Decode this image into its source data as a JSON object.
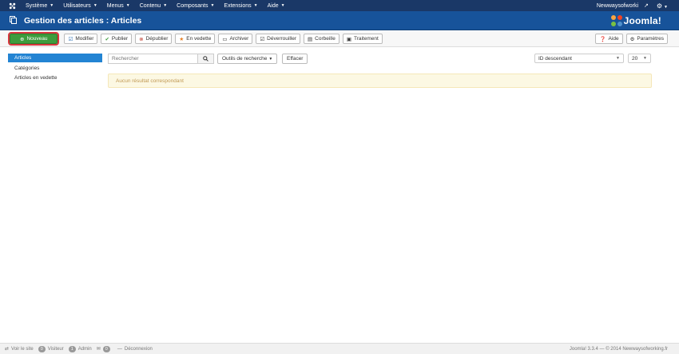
{
  "topnav": {
    "menus": [
      {
        "label": "Système"
      },
      {
        "label": "Utilisateurs"
      },
      {
        "label": "Menus"
      },
      {
        "label": "Contenu"
      },
      {
        "label": "Composants"
      },
      {
        "label": "Extensions"
      },
      {
        "label": "Aide"
      }
    ],
    "user": "Newwaysofworki"
  },
  "header": {
    "title": "Gestion des articles : Articles",
    "brand": "Joomla!"
  },
  "toolbar": {
    "new": "Nouveau",
    "edit": "Modifier",
    "publish": "Publier",
    "unpublish": "Dépublier",
    "feature": "En vedette",
    "archive": "Archiver",
    "checkin": "Déverrouiller",
    "trash": "Corbeille",
    "batch": "Traitement",
    "help": "Aide",
    "options": "Paramètres"
  },
  "sidebar": {
    "items": [
      {
        "label": "Articles",
        "active": true
      },
      {
        "label": "Catégories",
        "active": false
      },
      {
        "label": "Articles en vedette",
        "active": false
      }
    ]
  },
  "filters": {
    "search_placeholder": "Rechercher",
    "search_tools": "Outils de recherche",
    "clear": "Effacer",
    "ordering": "ID descendant",
    "limit": "20"
  },
  "alert": {
    "message": "Aucun résultat correspondant"
  },
  "footer": {
    "view_site": "Voir le site",
    "visitors_count": "0",
    "visitors_label": "Visiteur",
    "admins_count": "1",
    "admins_label": "Admin",
    "messages_count": "0",
    "logout": "Déconnexion",
    "copyright": "Joomla! 3.3.4 — © 2014 Newwaysofworking.fr"
  },
  "colors": {
    "topnav_bg": "#1a3867",
    "header_bg": "#17539a",
    "new_button": "#3d9c3d",
    "highlight_outline": "#d9363e",
    "sidebar_active": "#2384d3",
    "alert_bg": "#fcf8e3"
  }
}
